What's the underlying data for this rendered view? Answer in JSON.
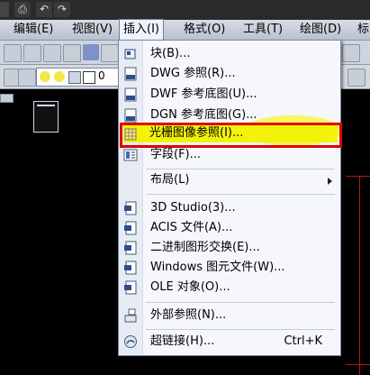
{
  "quick_access": {
    "icons": [
      "print-icon",
      "undo-icon",
      "redo-icon"
    ]
  },
  "menubar": {
    "items": [
      "编辑(E)",
      "视图(V)",
      "插入(I)",
      "格式(O)",
      "工具(T)",
      "绘图(D)",
      "标"
    ],
    "active": "插入(I)"
  },
  "toolbar2": {
    "value": "0"
  },
  "insert_menu": {
    "items": [
      {
        "label": "块(B)...",
        "icon": "block-icon"
      },
      {
        "label": "DWG 参照(R)...",
        "icon": "dwg-icon"
      },
      {
        "label": "DWF 参考底图(U)...",
        "icon": "dwf-icon"
      },
      {
        "label": "DGN 参考底图(G)...",
        "icon": "dgn-icon"
      },
      {
        "label": "光栅图像参照(I)...",
        "icon": "raster-image-icon",
        "highlighted": true
      },
      {
        "label": "字段(F)...",
        "icon": "field-icon"
      },
      {
        "label": "布局(L)",
        "submenu": true
      },
      {
        "label": "3D Studio(3)...",
        "icon": "3ds-icon"
      },
      {
        "label": "ACIS 文件(A)...",
        "icon": "acis-icon"
      },
      {
        "label": "二进制图形交换(E)...",
        "icon": "dxb-icon"
      },
      {
        "label": "Windows 图元文件(W)...",
        "icon": "wmf-icon"
      },
      {
        "label": "OLE 对象(O)...",
        "icon": "ole-icon"
      },
      {
        "label": "外部参照(N)...",
        "icon": "xref-icon"
      },
      {
        "label": "超链接(H)...",
        "shortcut": "Ctrl+K",
        "icon": "hyperlink-icon"
      }
    ]
  },
  "colors": {
    "highlight": "#f2f20a",
    "annotation_box": "#e00000",
    "menu_bg": "#f5f7fb"
  }
}
